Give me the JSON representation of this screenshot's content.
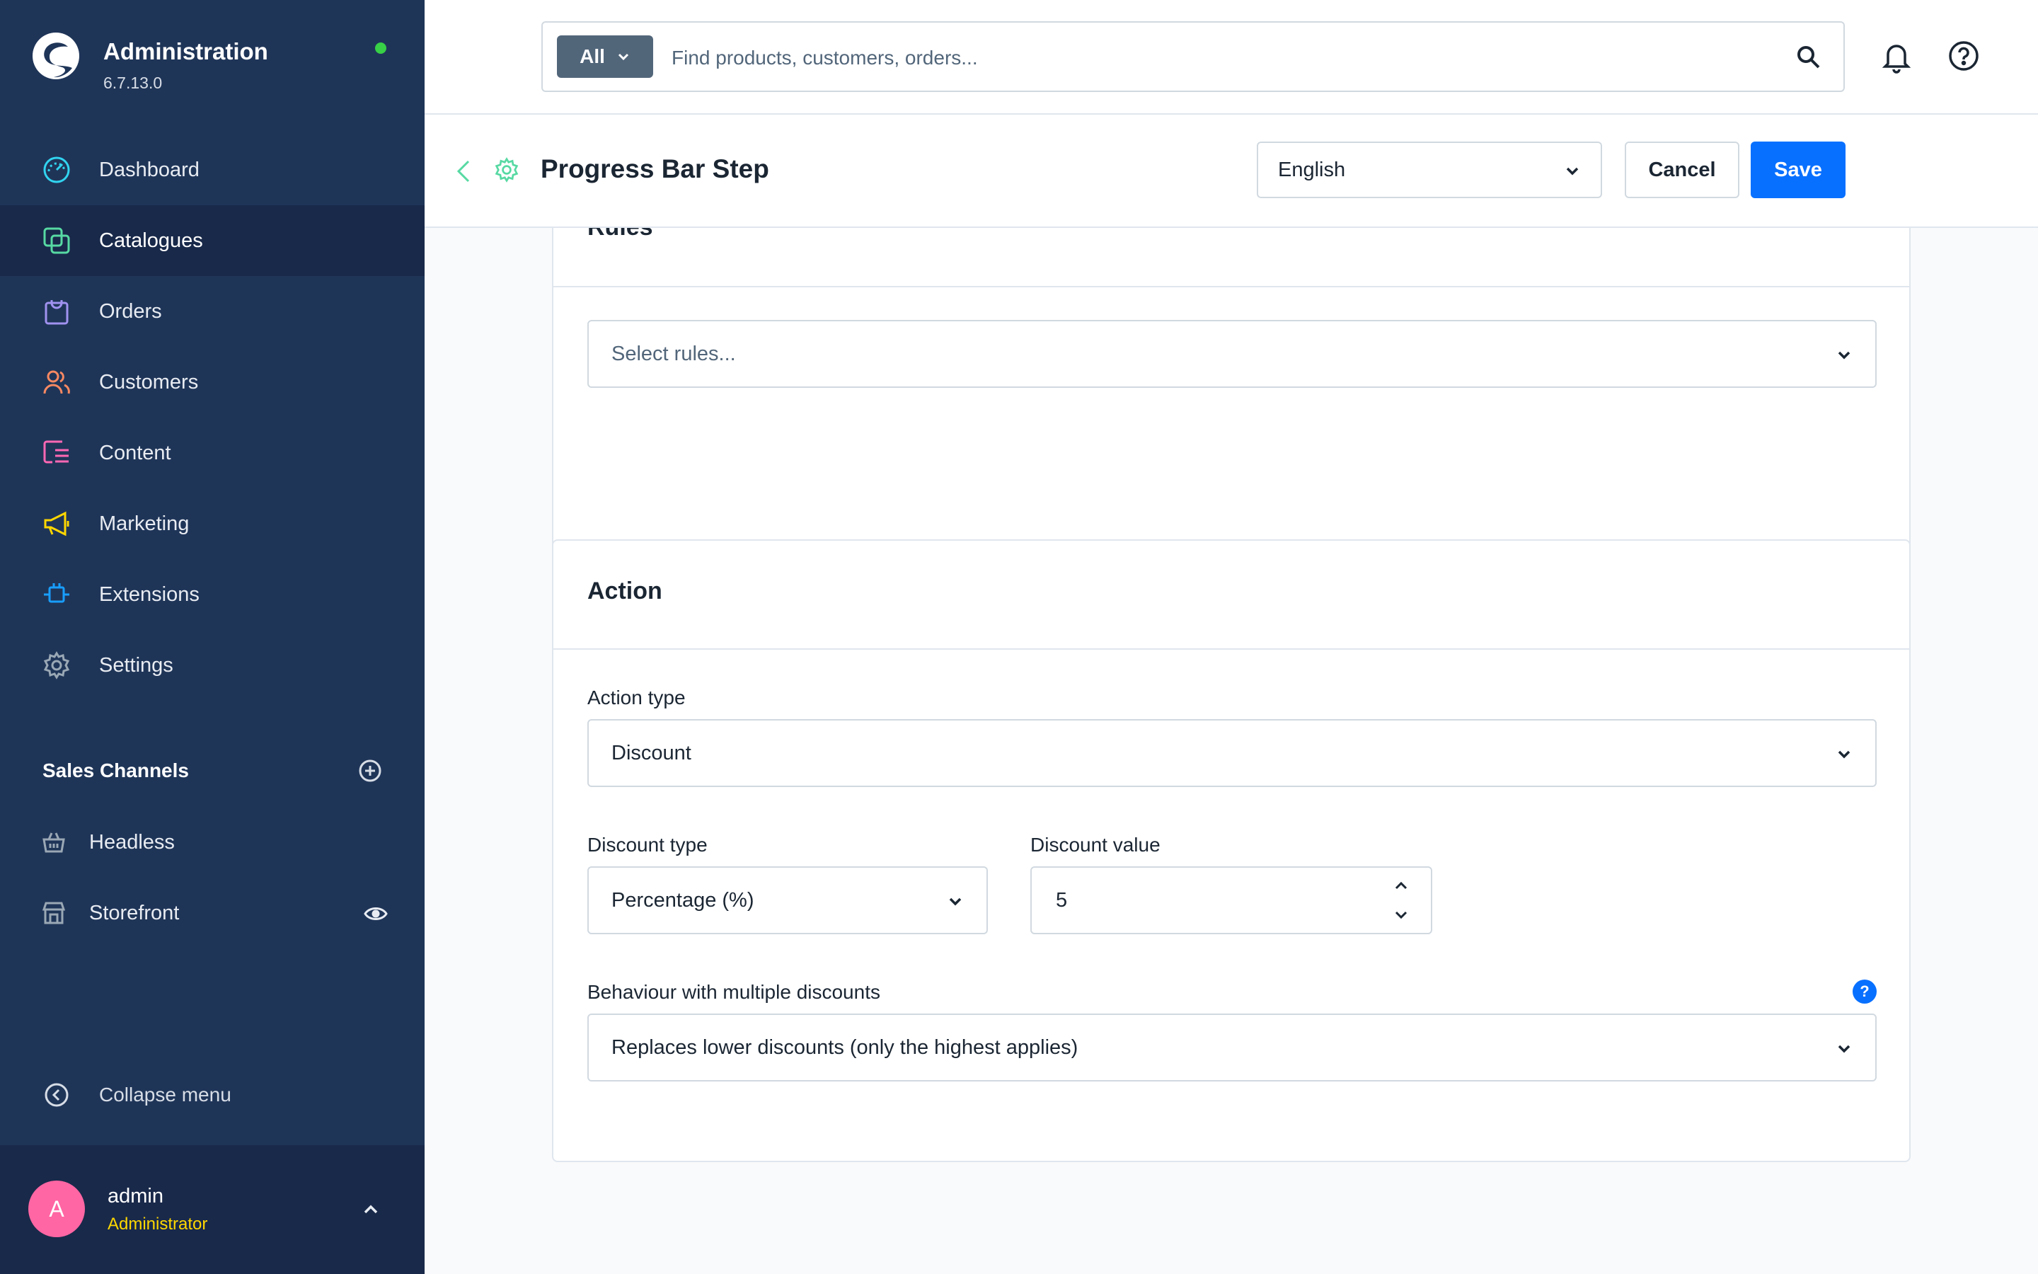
{
  "app": {
    "title": "Administration",
    "version": "6.7.13.0"
  },
  "nav": {
    "items": [
      {
        "label": "Dashboard",
        "icon": "dashboard-icon",
        "color": "#31d4f0"
      },
      {
        "label": "Catalogues",
        "icon": "catalogues-icon",
        "color": "#57d9a3"
      },
      {
        "label": "Orders",
        "icon": "orders-icon",
        "color": "#a092f0"
      },
      {
        "label": "Customers",
        "icon": "customers-icon",
        "color": "#f88962"
      },
      {
        "label": "Content",
        "icon": "content-icon",
        "color": "#ff68b4"
      },
      {
        "label": "Marketing",
        "icon": "marketing-icon",
        "color": "#ffd700"
      },
      {
        "label": "Extensions",
        "icon": "extensions-icon",
        "color": "#189eff"
      },
      {
        "label": "Settings",
        "icon": "settings-icon",
        "color": "#9aa8b5"
      }
    ],
    "active": "Catalogues"
  },
  "sales_channels": {
    "title": "Sales Channels",
    "items": [
      {
        "label": "Headless",
        "icon": "basket-icon"
      },
      {
        "label": "Storefront",
        "icon": "storefront-icon"
      }
    ]
  },
  "sidebar_footer": {
    "collapse_label": "Collapse menu"
  },
  "user": {
    "initial": "A",
    "name": "admin",
    "role": "Administrator"
  },
  "search": {
    "type_label": "All",
    "placeholder": "Find products, customers, orders..."
  },
  "smartbar": {
    "title": "Progress Bar Step",
    "language": "English",
    "cancel_label": "Cancel",
    "save_label": "Save"
  },
  "rules_card": {
    "title": "Rules",
    "select_placeholder": "Select rules..."
  },
  "action_card": {
    "title": "Action",
    "action_type_label": "Action type",
    "action_type_value": "Discount",
    "discount_type_label": "Discount type",
    "discount_type_value": "Percentage (%)",
    "discount_value_label": "Discount value",
    "discount_value": "5",
    "behaviour_label": "Behaviour with multiple discounts",
    "behaviour_value": "Replaces lower discounts (only the highest applies)",
    "help_glyph": "?"
  },
  "colors": {
    "sidebar_bg": "#1f3558",
    "sidebar_active": "#19294a",
    "primary": "#0870ff",
    "online": "#37d046",
    "avatar": "#ff66a3",
    "role_text": "#ffd700"
  }
}
